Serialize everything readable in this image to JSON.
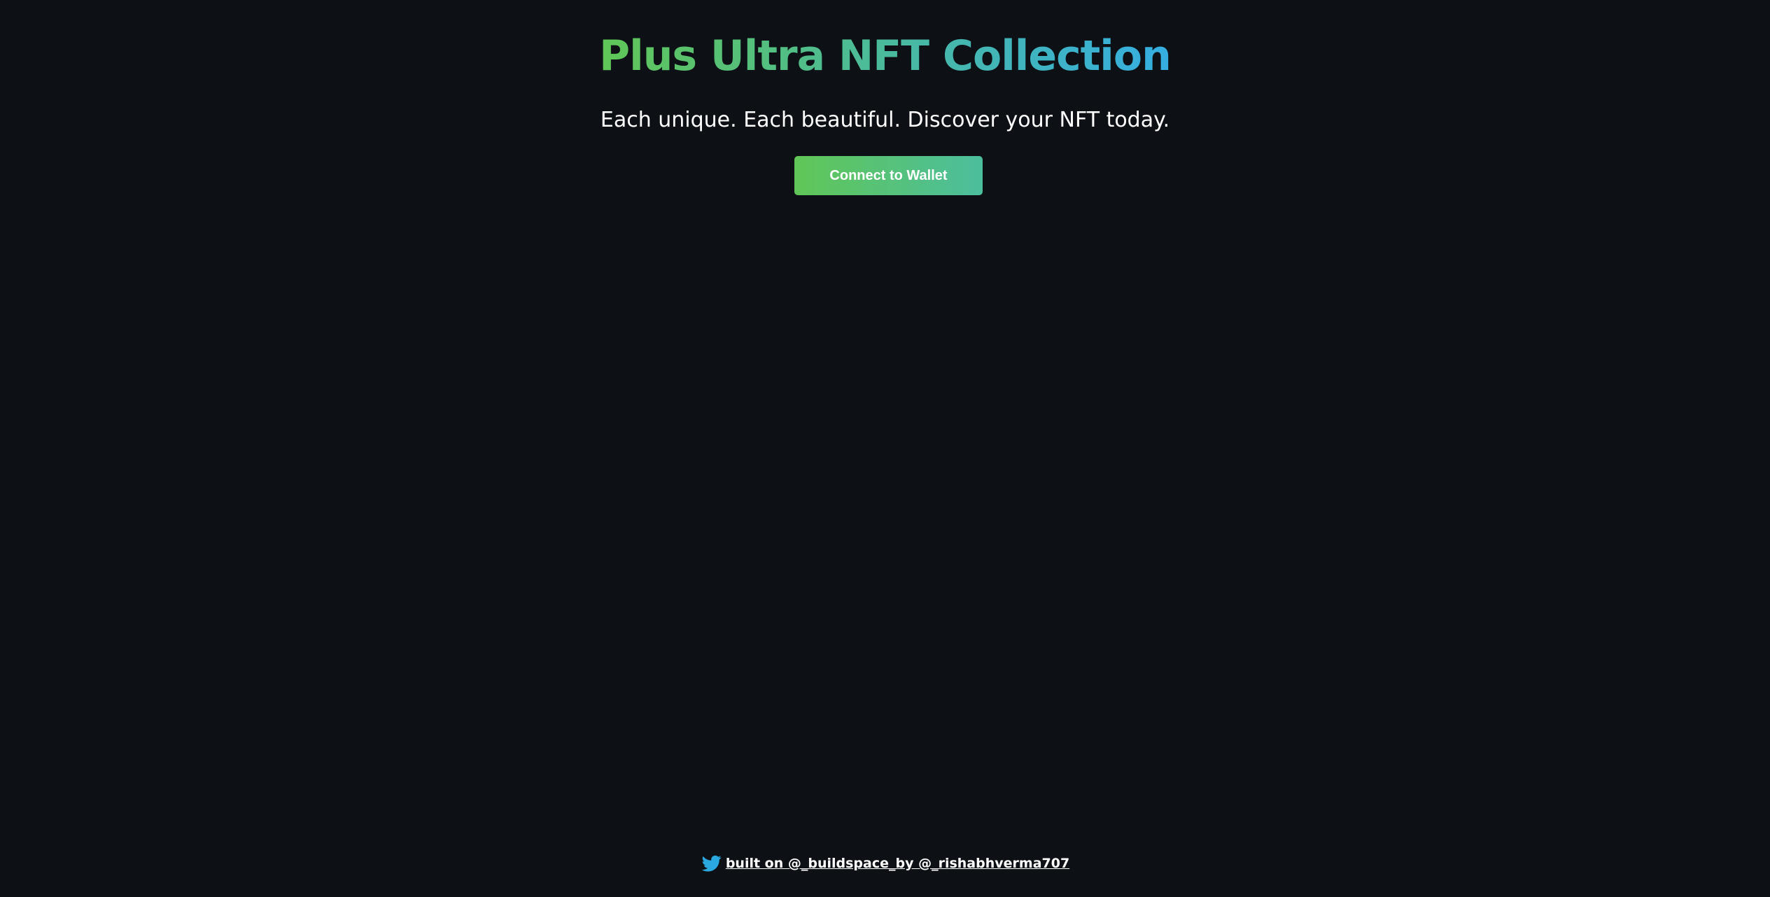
{
  "header": {
    "title": "Plus Ultra NFT Collection",
    "subtitle": "Each unique. Each beautiful. Discover your NFT today.",
    "title_gradient": [
      "#60c657",
      "#35aee2"
    ]
  },
  "actions": {
    "connect_label": "Connect to Wallet",
    "button_gradient": [
      "#60c657",
      "#4cbe9d"
    ]
  },
  "footer": {
    "icon": "twitter-icon",
    "icon_color": "#2aa9e0",
    "link_text": "built on @_buildspace_by @_rishabhverma707"
  },
  "theme": {
    "background": "#0d1116",
    "text": "#ffffff"
  }
}
